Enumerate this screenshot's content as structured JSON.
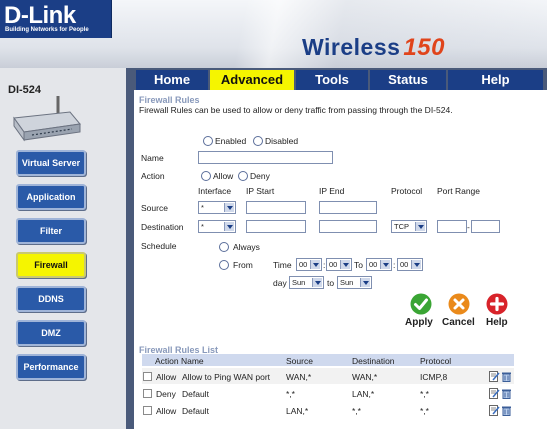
{
  "brand": {
    "logo": "D-Link",
    "tagline": "Building Networks for People",
    "product_prefix": "Wireless",
    "product_number": "150"
  },
  "device": {
    "model": "DI-524"
  },
  "nav": {
    "tabs": [
      {
        "label": "Home"
      },
      {
        "label": "Advanced"
      },
      {
        "label": "Tools"
      },
      {
        "label": "Status"
      },
      {
        "label": "Help"
      }
    ],
    "sidebar": [
      {
        "label": "Virtual Server"
      },
      {
        "label": "Application"
      },
      {
        "label": "Filter"
      },
      {
        "label": "Firewall"
      },
      {
        "label": "DDNS"
      },
      {
        "label": "DMZ"
      },
      {
        "label": "Performance"
      }
    ]
  },
  "firewall": {
    "title": "Firewall Rules",
    "description": "Firewall Rules can be used to allow or deny traffic from passing through the DI-524.",
    "enabled_label": "Enabled",
    "disabled_label": "Disabled",
    "name_label": "Name",
    "name_value": "",
    "action_label": "Action",
    "allow_label": "Allow",
    "deny_label": "Deny",
    "col_interface": "Interface",
    "col_ip_start": "IP Start",
    "col_ip_end": "IP End",
    "col_protocol": "Protocol",
    "col_port_range": "Port Range",
    "source_label": "Source",
    "destination_label": "Destination",
    "source_interface": "*",
    "dest_interface": "*",
    "dest_protocol": "TCP",
    "port_sep": "-",
    "schedule_label": "Schedule",
    "always_label": "Always",
    "from_label": "From",
    "time_label": "Time",
    "to_label": "To",
    "day_label": "day",
    "day_to_label": "to",
    "time_from_h": "00",
    "time_from_m": "00",
    "time_to_h": "00",
    "time_to_m": "00",
    "day_from": "Sun",
    "day_to": "Sun"
  },
  "buttons": {
    "apply": "Apply",
    "cancel": "Cancel",
    "help": "Help"
  },
  "list": {
    "title": "Firewall Rules List",
    "headers": [
      "Action Name",
      "Source",
      "Destination",
      "Protocol"
    ],
    "rows": [
      {
        "action": "Allow",
        "name": "Allow to Ping WAN port",
        "source": "WAN,*",
        "destination": "WAN,*",
        "protocol": "ICMP,8"
      },
      {
        "action": "Deny",
        "name": "Default",
        "source": "*,*",
        "destination": "LAN,*",
        "protocol": "*,*"
      },
      {
        "action": "Allow",
        "name": "Default",
        "source": "LAN,*",
        "destination": "*,*",
        "protocol": "*,*"
      }
    ]
  },
  "colors": {
    "nav_blue": "#1b3e86",
    "active_yellow": "#f5f500",
    "frame": "#4a5a7a"
  }
}
